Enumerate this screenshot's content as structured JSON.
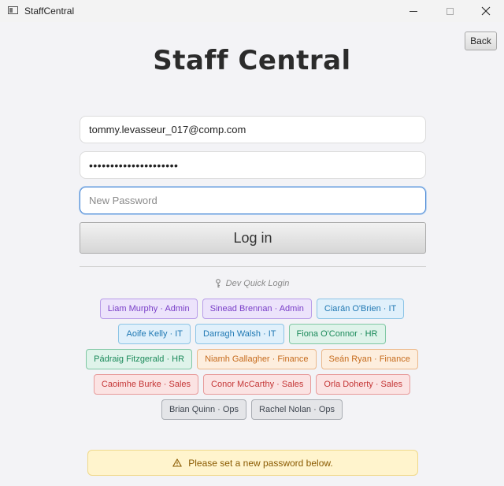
{
  "window": {
    "title": "StaffCentral"
  },
  "header": {
    "back_label": "Back",
    "app_title": "Staff Central"
  },
  "form": {
    "email_value": "tommy.levasseur_017@comp.com",
    "password_mask": "•••••••••••••••••••••",
    "new_password_placeholder": "New Password",
    "new_password_value": "",
    "login_label": "Log in"
  },
  "dev": {
    "label": "Dev Quick Login",
    "rows": [
      [
        {
          "label": "Liam Murphy · Admin",
          "role": "admin"
        },
        {
          "label": "Sinead Brennan · Admin",
          "role": "admin"
        },
        {
          "label": "Ciarán O'Brien · IT",
          "role": "it"
        }
      ],
      [
        {
          "label": "Aoife Kelly · IT",
          "role": "it"
        },
        {
          "label": "Darragh Walsh · IT",
          "role": "it"
        },
        {
          "label": "Fiona O'Connor · HR",
          "role": "hr"
        }
      ],
      [
        {
          "label": "Pádraig Fitzgerald · HR",
          "role": "hr"
        },
        {
          "label": "Niamh Gallagher · Finance",
          "role": "finance"
        },
        {
          "label": "Seán Ryan · Finance",
          "role": "finance"
        }
      ],
      [
        {
          "label": "Caoimhe Burke · Sales",
          "role": "sales"
        },
        {
          "label": "Conor McCarthy · Sales",
          "role": "sales"
        },
        {
          "label": "Orla Doherty · Sales",
          "role": "sales"
        }
      ],
      [
        {
          "label": "Brian Quinn · Ops",
          "role": "ops"
        },
        {
          "label": "Rachel Nolan · Ops",
          "role": "ops"
        }
      ]
    ]
  },
  "notice": {
    "icon": "warning-icon",
    "text": "Please set a new password below."
  },
  "colors": {
    "focus": "#4d8ad6",
    "admin": "#7a3fc8",
    "it": "#1f78b3",
    "hr": "#1b8a5a",
    "finance": "#c66b1c",
    "sales": "#c43636",
    "ops": "#3f4650",
    "notice_bg": "#fff4cd"
  }
}
